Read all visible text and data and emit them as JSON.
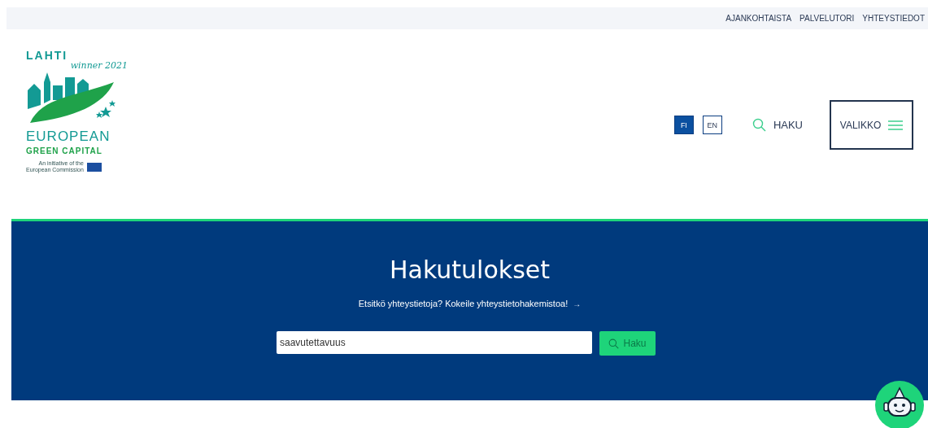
{
  "top_links": [
    "AJANKOHTAISTA",
    "PALVELUTORI",
    "YHTEYSTIEDOT"
  ],
  "logo": {
    "city": "LAHTI",
    "winner": "winner 2021",
    "line_1": "EUROPEAN",
    "line_2": "GREEN CAPITAL",
    "initiative": [
      "An initiative of the",
      "European Commission"
    ]
  },
  "languages": [
    {
      "label": "FI",
      "selected": true
    },
    {
      "label": "EN",
      "selected": false
    }
  ],
  "search_link": "HAKU",
  "menu_button": "VALIKKO",
  "banner": {
    "title": "Hakutulokset",
    "subtitle": "Etsitkö yhteystietoja? Kokeile yhteystietohakemistoa!",
    "arrow": "→",
    "search": {
      "value": "saavutettavuus",
      "button": "Haku"
    }
  }
}
